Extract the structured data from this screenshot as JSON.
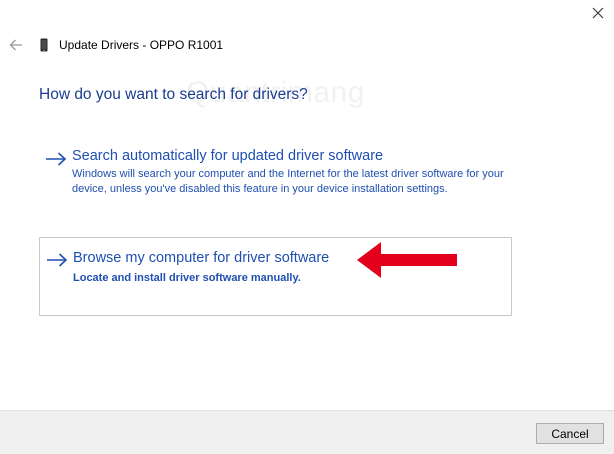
{
  "window": {
    "title": "Update Drivers - OPPO R1001"
  },
  "question": "How do you want to search for drivers?",
  "options": [
    {
      "title": "Search automatically for updated driver software",
      "description": "Windows will search your computer and the Internet for the latest driver software for your device, unless you've disabled this feature in your device installation settings."
    },
    {
      "title": "Browse my computer for driver software",
      "description": "Locate and install driver software manually."
    }
  ],
  "watermark": "Quantrimang",
  "footer": {
    "cancel_label": "Cancel"
  },
  "colors": {
    "link_blue": "#1f4fb0",
    "heading_blue": "#1a3d8f",
    "annotation_red": "#e3001b",
    "footer_bg": "#f0f0f0"
  },
  "icons": {
    "close": "close-icon",
    "back": "back-arrow-icon",
    "device": "phone-device-icon",
    "option_arrow": "right-arrow-icon",
    "annotation": "red-pointer-arrow"
  }
}
